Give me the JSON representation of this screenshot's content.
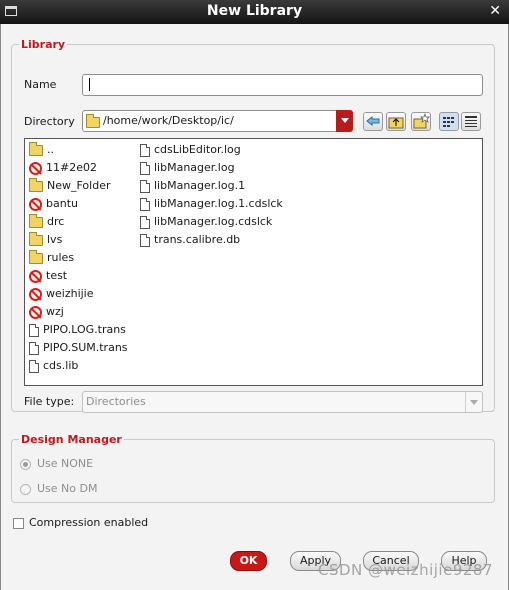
{
  "window": {
    "title": "New Library"
  },
  "library": {
    "group_title": "Library",
    "name_label": "Name",
    "name_value": "",
    "directory_label": "Directory",
    "directory_path": "/home/work/Desktop/ic/",
    "toolbar_icons": [
      "back-icon",
      "up-folder-icon",
      "new-folder-icon",
      "list-view-icon",
      "detail-view-icon"
    ],
    "files_col1": [
      {
        "name": "..",
        "icon": "folder"
      },
      {
        "name": "11#2e02",
        "icon": "no-entry"
      },
      {
        "name": "New_Folder",
        "icon": "folder"
      },
      {
        "name": "bantu",
        "icon": "no-entry"
      },
      {
        "name": "drc",
        "icon": "folder"
      },
      {
        "name": "lvs",
        "icon": "folder"
      },
      {
        "name": "rules",
        "icon": "folder"
      },
      {
        "name": "test",
        "icon": "no-entry"
      },
      {
        "name": "weizhijie",
        "icon": "no-entry"
      },
      {
        "name": "wzj",
        "icon": "no-entry"
      },
      {
        "name": "PIPO.LOG.trans",
        "icon": "file"
      },
      {
        "name": "PIPO.SUM.trans",
        "icon": "file"
      },
      {
        "name": "cds.lib",
        "icon": "file"
      }
    ],
    "files_col2": [
      {
        "name": "cdsLibEditor.log",
        "icon": "file"
      },
      {
        "name": "libManager.log",
        "icon": "file"
      },
      {
        "name": "libManager.log.1",
        "icon": "file"
      },
      {
        "name": "libManager.log.1.cdslck",
        "icon": "file"
      },
      {
        "name": "libManager.log.cdslck",
        "icon": "file"
      },
      {
        "name": "trans.calibre.db",
        "icon": "file"
      }
    ],
    "file_type_label": "File type:",
    "file_type_value": "Directories"
  },
  "design_manager": {
    "group_title": "Design Manager",
    "options": [
      "Use NONE",
      "Use No DM"
    ],
    "selected": "Use NONE"
  },
  "compression": {
    "label": "Compression enabled",
    "checked": false
  },
  "buttons": {
    "ok": "OK",
    "apply": "Apply",
    "cancel": "Cancel",
    "help": "Help"
  },
  "watermark": "CSDN @weizhijie9287"
}
